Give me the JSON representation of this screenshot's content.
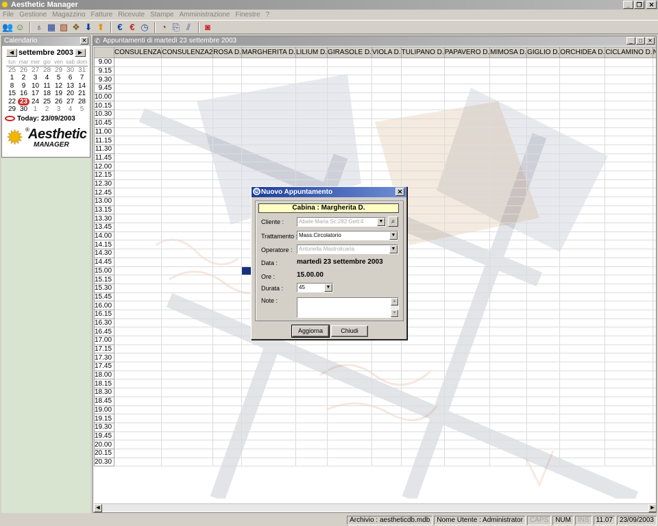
{
  "app": {
    "title": "Aesthetic Manager"
  },
  "menu": [
    "File",
    "Gestione",
    "Magazzino",
    "Fatture",
    "Ricevute",
    "Stampe",
    "Amministrazione",
    "Finestre",
    "?"
  ],
  "toolbar_icons": [
    "users-icon",
    "user-icon",
    "bottle-icon",
    "grid-icon",
    "chart-icon",
    "boxes-icon",
    "arrow-down-icon",
    "arrow-up-icon",
    "euro-icon",
    "euro-red-icon",
    "clock-icon",
    "timer-icon",
    "doc-icon",
    "graph-icon",
    "stop-icon"
  ],
  "calendar": {
    "panel_title": "Calendario",
    "month": "settembre 2003",
    "day_names": [
      "lun",
      "mar",
      "mer",
      "gio",
      "ven",
      "sab",
      "dom"
    ],
    "weeks": [
      [
        "25",
        "26",
        "27",
        "28",
        "29",
        "30",
        "31"
      ],
      [
        "1",
        "2",
        "3",
        "4",
        "5",
        "6",
        "7"
      ],
      [
        "8",
        "9",
        "10",
        "11",
        "12",
        "13",
        "14"
      ],
      [
        "15",
        "16",
        "17",
        "18",
        "19",
        "20",
        "21"
      ],
      [
        "22",
        "23",
        "24",
        "25",
        "26",
        "27",
        "28"
      ],
      [
        "29",
        "30",
        "1",
        "2",
        "3",
        "4",
        "5"
      ]
    ],
    "today_text": "Today: 23/09/2003",
    "today_day": "23"
  },
  "logo": {
    "line1": "Aesthetic",
    "line2": "MANAGER",
    "mark": "®"
  },
  "schedule": {
    "window_title": "Appuntamenti di martedì 23 settembre 2003",
    "columns": [
      "CONSULENZA",
      "CONSULENZA2",
      "ROSA D.",
      "MARGHERITA D.",
      "LILIUM D.",
      "GIRASOLE D.",
      "VIOLA D.",
      "TULIPANO D.",
      "PAPAVERO D.",
      "MIMOSA D.",
      "GIGLIO D.",
      "ORCHIDEA D.",
      "CICLAMINO D.",
      "NINFEA U."
    ],
    "times": [
      "9.00",
      "9.15",
      "9.30",
      "9.45",
      "10.00",
      "10.15",
      "10.30",
      "10.45",
      "11.00",
      "11.15",
      "11.30",
      "11.45",
      "12.00",
      "12.15",
      "12.30",
      "12.45",
      "13.00",
      "13.15",
      "13.30",
      "13.45",
      "14.00",
      "14.15",
      "14.30",
      "14.45",
      "15.00",
      "15.15",
      "15.30",
      "15.45",
      "16.00",
      "16.15",
      "16.30",
      "16.45",
      "17.00",
      "17.15",
      "17.30",
      "17.45",
      "18.00",
      "18.15",
      "18.30",
      "18.45",
      "19.00",
      "19.15",
      "19.30",
      "19.45",
      "20.00",
      "20.15",
      "20.30"
    ],
    "selected_time": "15.00",
    "selected_column": "MARGHERITA D."
  },
  "dialog": {
    "title": "Nuovo Appuntamento",
    "cabina": "Cabina : Margherita D.",
    "cliente_label": "Cliente :",
    "cliente_value": "Abate Maria Sc:282 Gett:4",
    "trattamento_label": "Trattamento :",
    "trattamento_value": "Mass.Circolatorio",
    "operatore_label": "Operatore :",
    "operatore_value": "Antonella Mastrolicaria",
    "data_label": "Data :",
    "data_value": "martedì 23 settembre 2003",
    "ore_label": "Ore :",
    "ore_value": "15.00.00",
    "durata_label": "Durata :",
    "durata_value": "45",
    "note_label": "Note :",
    "note_value": "",
    "aggiorna": "Aggiorna",
    "chiudi": "Chiudi"
  },
  "status": {
    "archivio": "Archivio : aestheticdb.mdb",
    "utente": "Nome Utente : Administrator",
    "caps": "CAPS",
    "num": "NUM",
    "ins": "INS",
    "time": "11.07",
    "date": "23/09/2003"
  }
}
